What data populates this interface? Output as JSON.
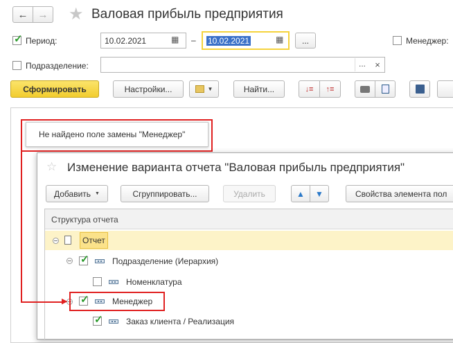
{
  "window": {
    "title": "Валовая прибыль предприятия"
  },
  "toolbar": {
    "period_label": "Период:",
    "date_from": "10.02.2021",
    "date_dash": "–",
    "date_to": "10.02.2021",
    "more_btn": "...",
    "manager_label": "Менеджер:",
    "subdivision_label": "Подразделение:",
    "subdivision_more": "...",
    "clear_icon": "×",
    "generate_button": "Сформировать",
    "settings_button": "Настройки...",
    "find_button": "Найти..."
  },
  "error": {
    "message": "Не найдено поле замены \"Менеджер\""
  },
  "dialog": {
    "title": "Изменение варианта отчета \"Валовая прибыль предприятия\"",
    "add_button": "Добавить",
    "group_button": "Сгруппировать...",
    "delete_button": "Удалить",
    "properties_button": "Свойства элемента пол",
    "tree_header": "Структура отчета",
    "tree": [
      {
        "label": "Отчет"
      },
      {
        "label": "Подразделение (Иерархия)"
      },
      {
        "label": "Номенклатура"
      },
      {
        "label": "Менеджер"
      },
      {
        "label": "Заказ клиента / Реализация"
      }
    ]
  },
  "colors": {
    "accent_yellow": "#f5d33c",
    "highlight_red": "#e02020",
    "selected_row": "#fdf3c8",
    "check_green": "#2a9a2a"
  }
}
